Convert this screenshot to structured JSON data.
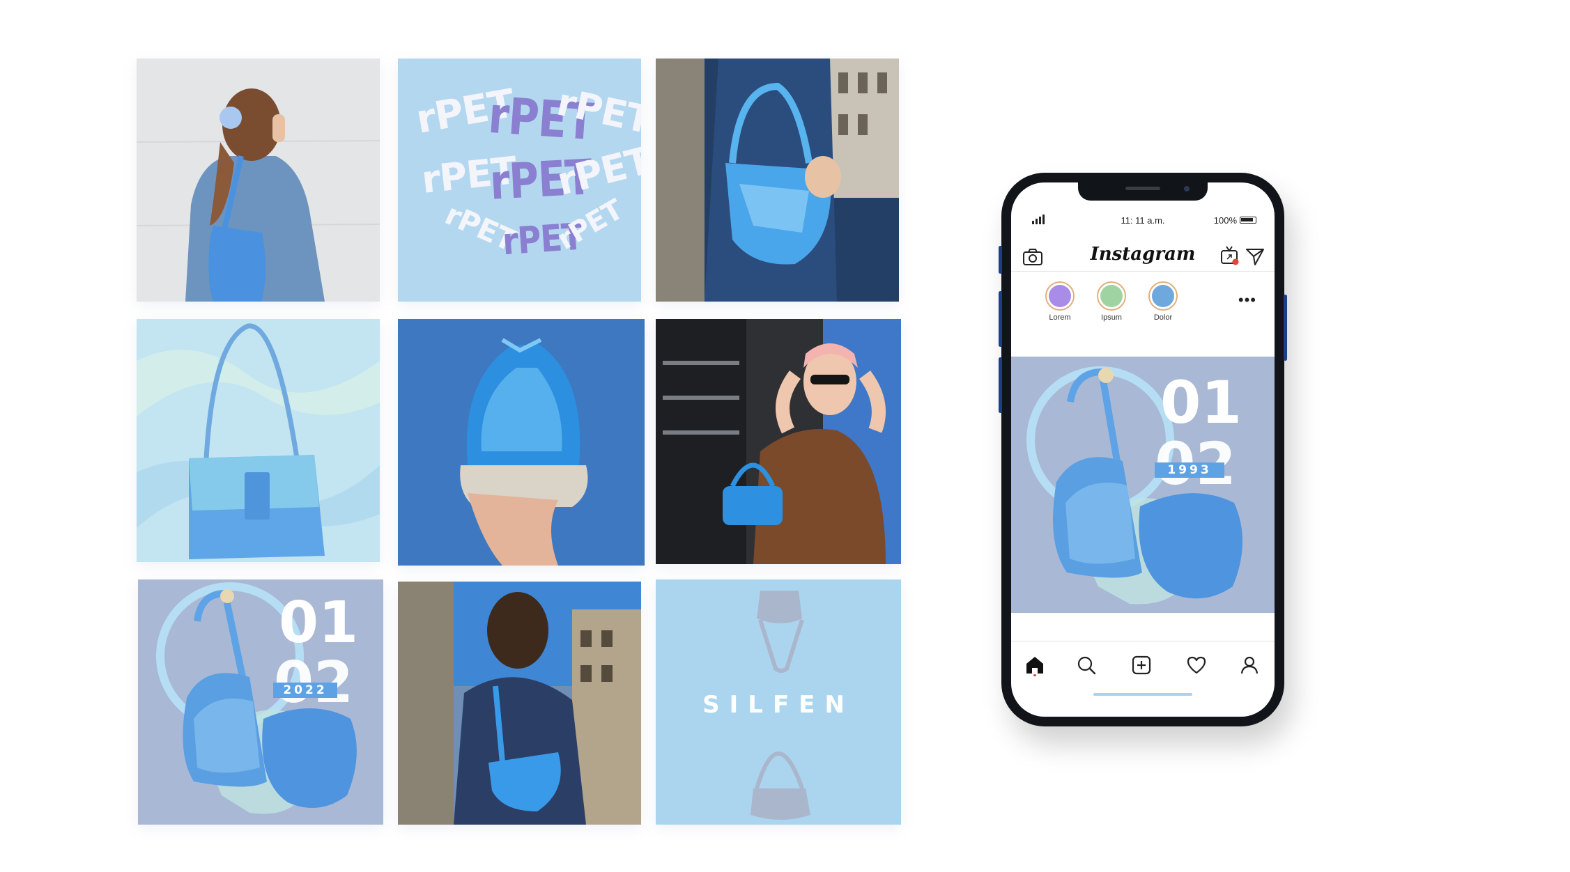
{
  "grid": {
    "rpet_word": "rPET",
    "poster": {
      "day": "01",
      "month": "02",
      "year": "2022"
    },
    "brand": "SILFEN"
  },
  "phone": {
    "status": {
      "time": "11: 11 a.m.",
      "battery": "100%"
    },
    "app_title": "Instagram",
    "stories": [
      {
        "label": "Lorem",
        "color": "#a98be8"
      },
      {
        "label": "Ipsum",
        "color": "#9fd3a2"
      },
      {
        "label": "Dolor",
        "color": "#6fa8dc"
      }
    ],
    "post": {
      "day": "01",
      "month": "02",
      "year": "1993"
    },
    "icons": {
      "header": [
        "camera-icon",
        "igtv-icon",
        "direct-message-icon"
      ],
      "nav": [
        "home-icon",
        "search-icon",
        "add-post-icon",
        "heart-icon",
        "profile-icon"
      ]
    }
  },
  "colors": {
    "accent_blue": "#5ea2e6",
    "light_blue": "#b4d7f0",
    "slate": "#a9b8d5",
    "story_ring": "#e0b07a",
    "notification_dot": "#e0453a"
  }
}
